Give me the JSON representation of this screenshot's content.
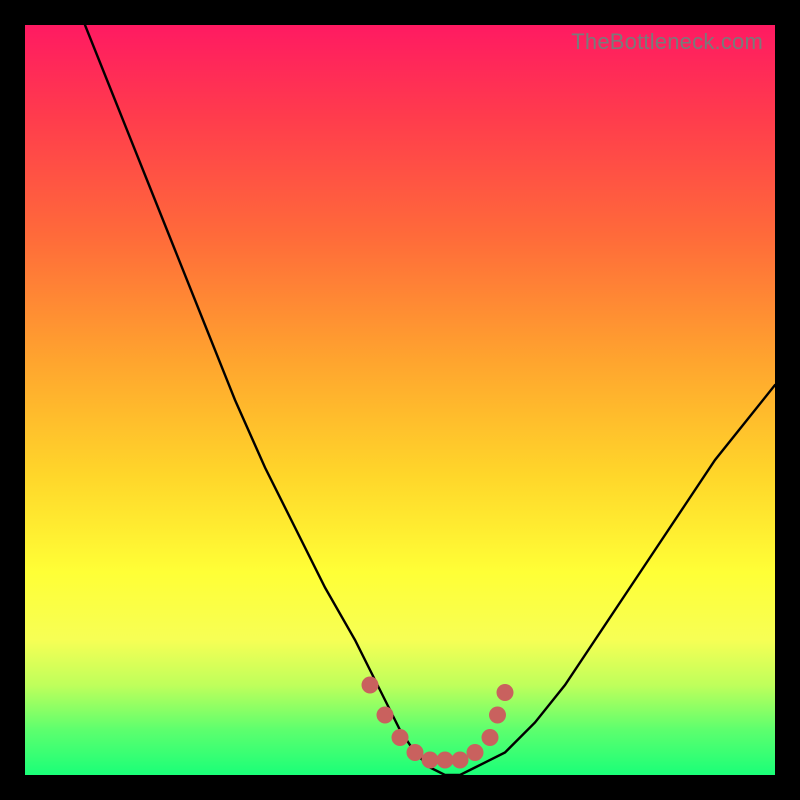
{
  "watermark": "TheBottleneck.com",
  "chart_data": {
    "type": "line",
    "title": "",
    "xlabel": "",
    "ylabel": "",
    "xlim": [
      0,
      100
    ],
    "ylim": [
      0,
      100
    ],
    "series": [
      {
        "name": "bottleneck-curve",
        "x": [
          8,
          12,
          16,
          20,
          24,
          28,
          32,
          36,
          40,
          44,
          48,
          50,
          52,
          54,
          56,
          58,
          60,
          64,
          68,
          72,
          76,
          80,
          84,
          88,
          92,
          96,
          100
        ],
        "y": [
          100,
          90,
          80,
          70,
          60,
          50,
          41,
          33,
          25,
          18,
          10,
          6,
          3,
          1,
          0,
          0,
          1,
          3,
          7,
          12,
          18,
          24,
          30,
          36,
          42,
          47,
          52
        ]
      }
    ],
    "markers": {
      "name": "highlight-band",
      "color": "#c9615e",
      "points": [
        {
          "x": 46,
          "y": 12
        },
        {
          "x": 48,
          "y": 8
        },
        {
          "x": 50,
          "y": 5
        },
        {
          "x": 52,
          "y": 3
        },
        {
          "x": 54,
          "y": 2
        },
        {
          "x": 56,
          "y": 2
        },
        {
          "x": 58,
          "y": 2
        },
        {
          "x": 60,
          "y": 3
        },
        {
          "x": 62,
          "y": 5
        },
        {
          "x": 63,
          "y": 8
        },
        {
          "x": 64,
          "y": 11
        }
      ]
    }
  }
}
